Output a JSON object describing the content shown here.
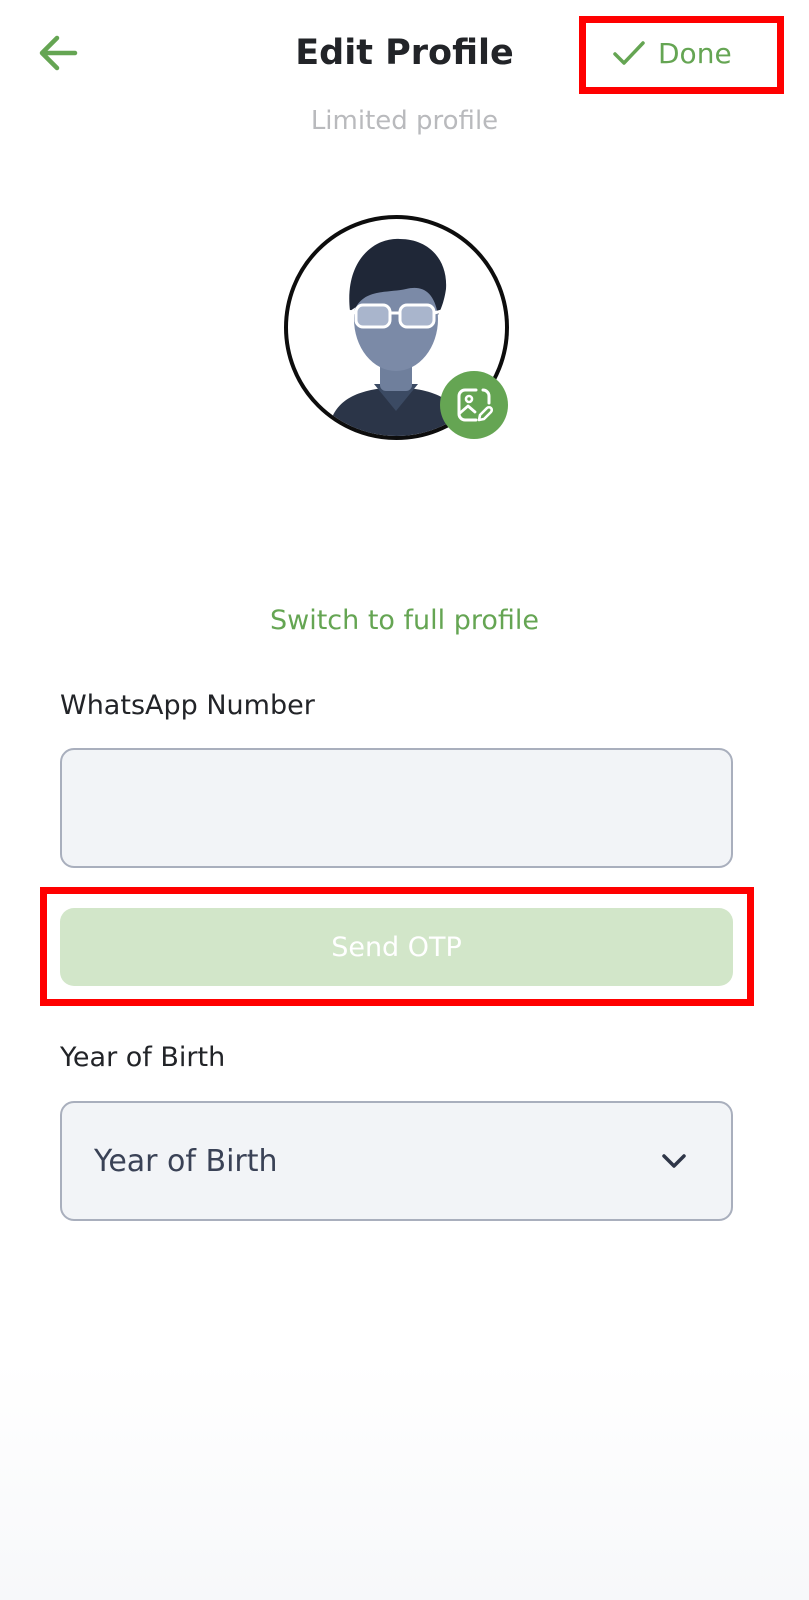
{
  "colors": {
    "accent": "#65a553",
    "highlight": "#ff0000",
    "otp_button_bg": "#d2e6c9"
  },
  "header": {
    "back_icon": "arrow-left-icon",
    "title": "Edit Profile",
    "done_icon": "check-icon",
    "done_label": "Done",
    "subtitle": "Limited profile"
  },
  "avatar": {
    "icon": "default-avatar-with-glasses",
    "edit_icon": "image-edit-icon"
  },
  "switch_link": "Switch to full profile",
  "whatsapp": {
    "label": "WhatsApp Number",
    "value": "",
    "send_otp_label": "Send OTP"
  },
  "year_of_birth": {
    "label": "Year of Birth",
    "selected": "Year of Birth",
    "chevron_icon": "chevron-down-icon"
  }
}
